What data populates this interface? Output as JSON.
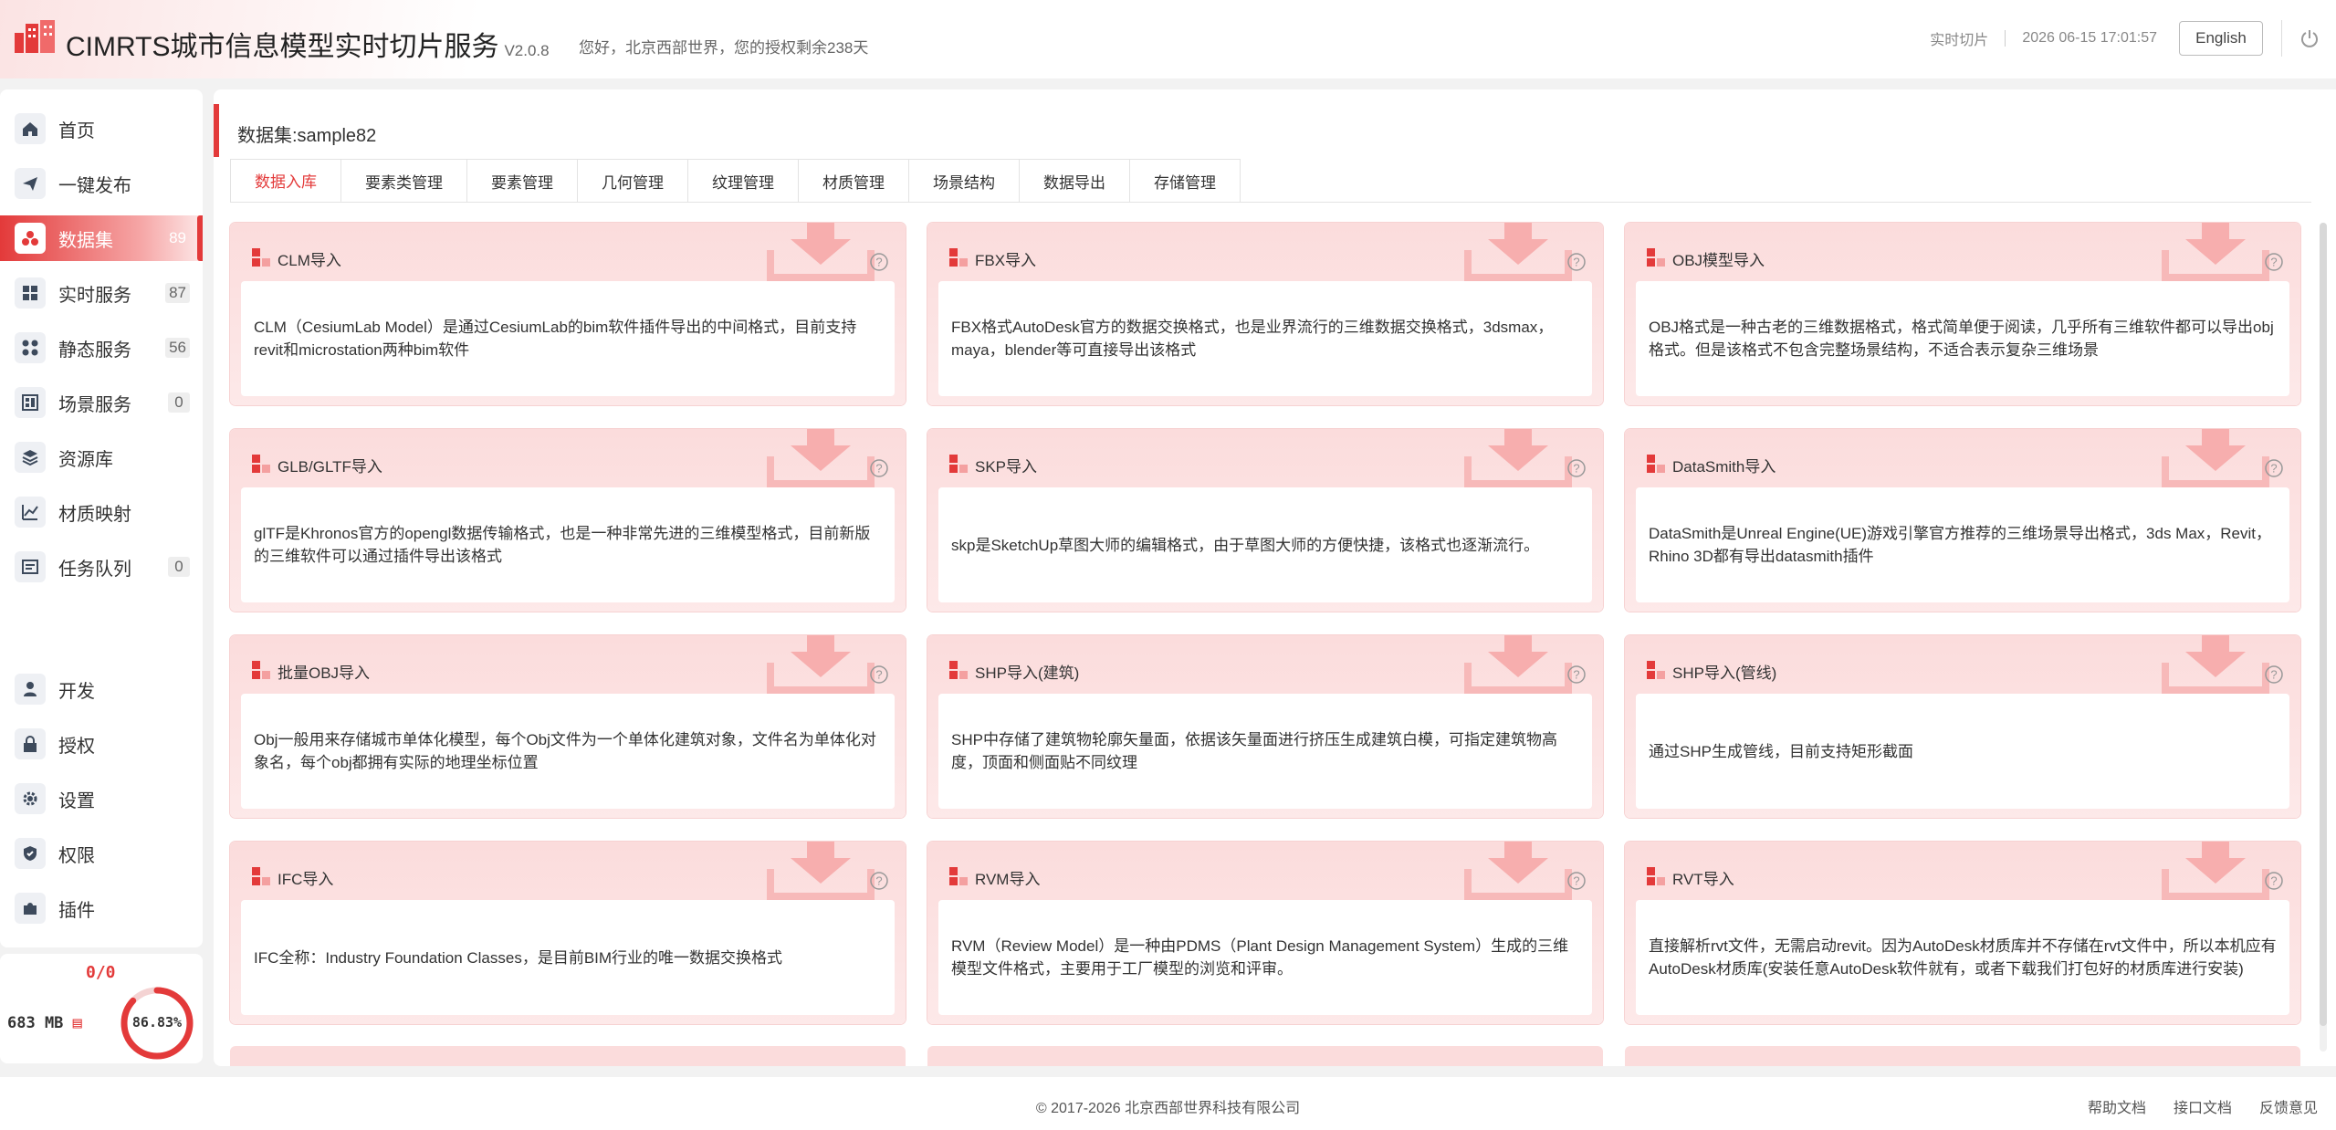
{
  "header": {
    "title": "CIMRTS城市信息模型实时切片服务",
    "version": "V2.0.8",
    "greeting": "您好，北京西部世界，您的授权剩余238天",
    "realtime_link": "实时切片",
    "datetime": "2026 06-15 17:01:57",
    "lang_button": "English",
    "icons": {
      "logo": "building-logo",
      "power": "power-icon"
    }
  },
  "sidebar": {
    "items": [
      {
        "label": "首页",
        "badge": null,
        "icon": "home-icon",
        "active": false
      },
      {
        "label": "一键发布",
        "badge": null,
        "icon": "send-icon",
        "active": false
      },
      {
        "label": "数据集",
        "badge": "89",
        "icon": "dataset-icon",
        "active": true
      },
      {
        "label": "实时服务",
        "badge": "87",
        "icon": "grid-icon",
        "active": false
      },
      {
        "label": "静态服务",
        "badge": "56",
        "icon": "cluster-icon",
        "active": false
      },
      {
        "label": "场景服务",
        "badge": "0",
        "icon": "scene-icon",
        "active": false
      },
      {
        "label": "资源库",
        "badge": null,
        "icon": "layers-icon",
        "active": false
      },
      {
        "label": "材质映射",
        "badge": null,
        "icon": "chart-icon",
        "active": false
      },
      {
        "label": "任务队列",
        "badge": "0",
        "icon": "queue-icon",
        "active": false
      },
      {
        "label": "开发",
        "badge": null,
        "icon": "dev-icon",
        "active": false
      },
      {
        "label": "授权",
        "badge": null,
        "icon": "lock-icon",
        "active": false
      },
      {
        "label": "设置",
        "badge": null,
        "icon": "gear-icon",
        "active": false
      },
      {
        "label": "权限",
        "badge": null,
        "icon": "shield-icon",
        "active": false
      },
      {
        "label": "插件",
        "badge": null,
        "icon": "plugin-icon",
        "active": false
      }
    ],
    "storage": {
      "ratio": "0/0",
      "size": "683 MB",
      "percent_label": "86.83%",
      "percent": 86.83
    }
  },
  "main": {
    "dataset_title": "数据集:sample82",
    "tabs": [
      {
        "label": "数据入库",
        "active": true
      },
      {
        "label": "要素类管理"
      },
      {
        "label": "要素管理"
      },
      {
        "label": "几何管理"
      },
      {
        "label": "纹理管理"
      },
      {
        "label": "材质管理"
      },
      {
        "label": "场景结构"
      },
      {
        "label": "数据导出"
      },
      {
        "label": "存储管理"
      }
    ],
    "cards": [
      {
        "title": "CLM导入",
        "desc": "CLM（CesiumLab Model）是通过CesiumLab的bim软件插件导出的中间格式，目前支持revit和microstation两种bim软件"
      },
      {
        "title": "FBX导入",
        "desc": "FBX格式AutoDesk官方的数据交换格式，也是业界流行的三维数据交换格式，3dsmax，maya，blender等可直接导出该格式"
      },
      {
        "title": "OBJ模型导入",
        "desc": "OBJ格式是一种古老的三维数据格式，格式简单便于阅读，几乎所有三维软件都可以导出obj格式。但是该格式不包含完整场景结构，不适合表示复杂三维场景"
      },
      {
        "title": "GLB/GLTF导入",
        "desc": "glTF是Khronos官方的opengl数据传输格式，也是一种非常先进的三维模型格式，目前新版的三维软件可以通过插件导出该格式"
      },
      {
        "title": "SKP导入",
        "desc": "skp是SketchUp草图大师的编辑格式，由于草图大师的方便快捷，该格式也逐渐流行。"
      },
      {
        "title": "DataSmith导入",
        "desc": "DataSmith是Unreal Engine(UE)游戏引擎官方推荐的三维场景导出格式，3ds Max，Revit，Rhino 3D都有导出datasmith插件"
      },
      {
        "title": "批量OBJ导入",
        "desc": "Obj一般用来存储城市单体化模型，每个Obj文件为一个单体化建筑对象，文件名为单体化对象名，每个obj都拥有实际的地理坐标位置"
      },
      {
        "title": "SHP导入(建筑)",
        "desc": "SHP中存储了建筑物轮廓矢量面，依据该矢量面进行挤压生成建筑白模，可指定建筑物高度，顶面和侧面贴不同纹理"
      },
      {
        "title": "SHP导入(管线)",
        "desc": "通过SHP生成管线，目前支持矩形截面"
      },
      {
        "title": "IFC导入",
        "desc": "IFC全称：Industry Foundation Classes，是目前BIM行业的唯一数据交换格式"
      },
      {
        "title": "RVM导入",
        "desc": "RVM（Review Model）是一种由PDMS（Plant Design Management System）生成的三维模型文件格式，主要用于工厂模型的浏览和评审。"
      },
      {
        "title": "RVT导入",
        "desc": "直接解析rvt文件，无需启动revit。因为AutoDesk材质库并不存储在rvt文件中，所以本机应有AutoDesk材质库(安装任意AutoDesk软件就有，或者下载我们打包好的材质库进行安装)"
      }
    ],
    "card_icons": {
      "mark": "squares-mark-icon",
      "background": "download-icon",
      "help": "help-icon"
    }
  },
  "footer": {
    "copyright": "© 2017-2026 北京西部世界科技有限公司",
    "links": [
      "帮助文档",
      "接口文档",
      "反馈意见"
    ]
  },
  "colors": {
    "accent": "#e33a3a",
    "card_bg": "#fbdcdc",
    "page_bg": "#f2f2f2"
  }
}
